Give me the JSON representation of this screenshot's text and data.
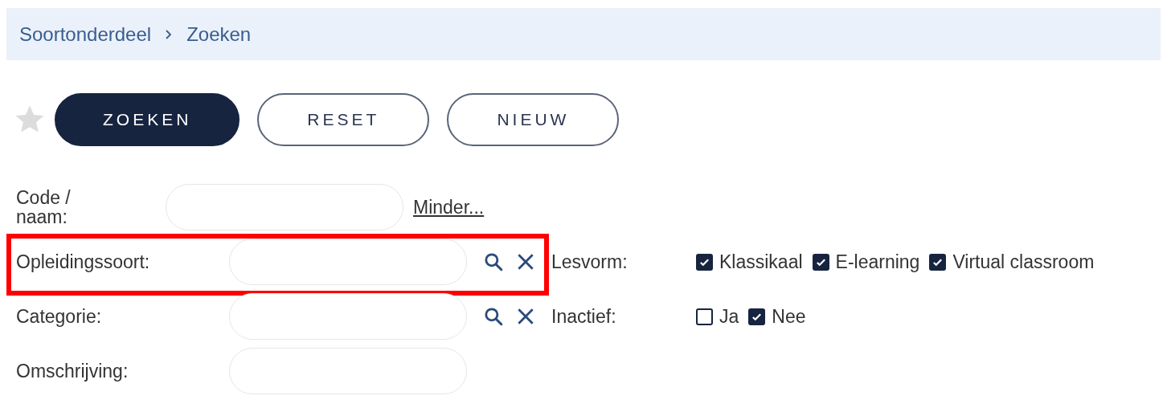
{
  "breadcrumb": [
    "Soortonderdeel",
    "Zoeken"
  ],
  "favorite": {
    "on": false
  },
  "buttons": [
    {
      "label": "ZOEKEN",
      "kind": "primary"
    },
    {
      "label": "RESET",
      "kind": "outline"
    },
    {
      "label": "NIEUW",
      "kind": "outline"
    }
  ],
  "fields": [
    {
      "label": "Code / naam:",
      "kind": "text-link",
      "link": "Minder...",
      "highlighted": false
    },
    {
      "label": "Opleidingssoort:",
      "kind": "lookup",
      "highlighted": true
    },
    {
      "label": "Categorie:",
      "kind": "lookup",
      "highlighted": false
    },
    {
      "label": "Omschrijving:",
      "kind": "text",
      "highlighted": false
    }
  ],
  "filters": [
    {
      "label": "Lesvorm:",
      "options": [
        {
          "label": "Klassikaal",
          "checked": true
        },
        {
          "label": "E-learning",
          "checked": true
        },
        {
          "label": "Virtual classroom",
          "checked": true
        }
      ]
    },
    {
      "label": "Inactief:",
      "options": [
        {
          "label": "Ja",
          "checked": false
        },
        {
          "label": "Nee",
          "checked": true
        }
      ]
    }
  ]
}
